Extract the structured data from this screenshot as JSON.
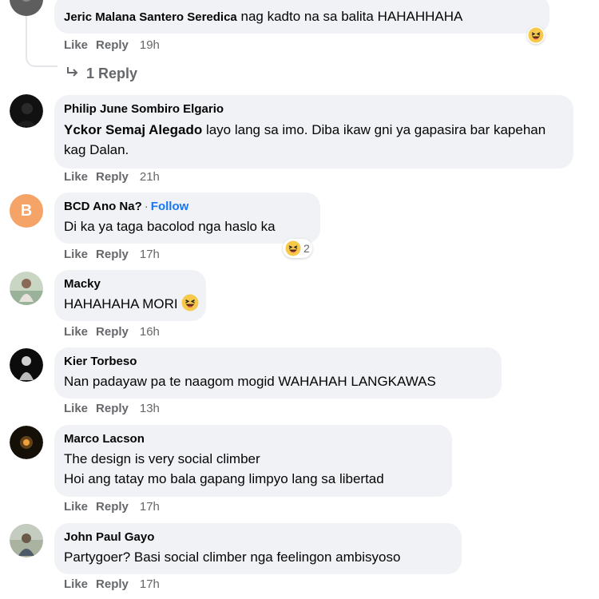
{
  "comments": [
    {
      "author": "Jeric Malana Santero Seredica",
      "text": "nag kadto na sa balita HAHAHHAHA",
      "actions": {
        "like": "Like",
        "reply": "Reply",
        "time": "19h"
      },
      "reaction_icon": "haha-emoji-icon",
      "replies_link": "1 Reply"
    },
    {
      "author": "Philip June Sombiro Elgario",
      "mention": "Yckor Semaj Alegado",
      "text": "layo lang sa imo. Diba ikaw gni ya gapasira bar kapehan kag Dalan.",
      "actions": {
        "like": "Like",
        "reply": "Reply",
        "time": "21h"
      }
    },
    {
      "author": "BCD Ano Na?",
      "separator": "·",
      "follow": "Follow",
      "avatar_letter": "B",
      "text": "Di ka ya taga bacolod nga haslo ka",
      "actions": {
        "like": "Like",
        "reply": "Reply",
        "time": "17h"
      },
      "reaction_count": "2"
    },
    {
      "author": "Macky",
      "text": "HAHAHAHA MORI",
      "actions": {
        "like": "Like",
        "reply": "Reply",
        "time": "16h"
      }
    },
    {
      "author": "Kier Torbeso",
      "text": "Nan padayaw pa te naagom mogid WAHAHAH LANGKAWAS",
      "actions": {
        "like": "Like",
        "reply": "Reply",
        "time": "13h"
      }
    },
    {
      "author": "Marco Lacson",
      "text_line1": "The design is very social climber",
      "text_line2": "Hoi ang tatay mo bala gapang limpyo lang sa libertad",
      "actions": {
        "like": "Like",
        "reply": "Reply",
        "time": "17h"
      }
    },
    {
      "author": "John Paul Gayo",
      "text": "Partygoer? Basi social climber nga feelingon ambisyoso",
      "actions": {
        "like": "Like",
        "reply": "Reply",
        "time": "17h"
      }
    }
  ],
  "colors": {
    "bubble": "#f0f2f5",
    "meta": "#65676b",
    "follow": "#1877f2",
    "avatar_b": "#f5a367",
    "haha": "#f7c94a"
  }
}
